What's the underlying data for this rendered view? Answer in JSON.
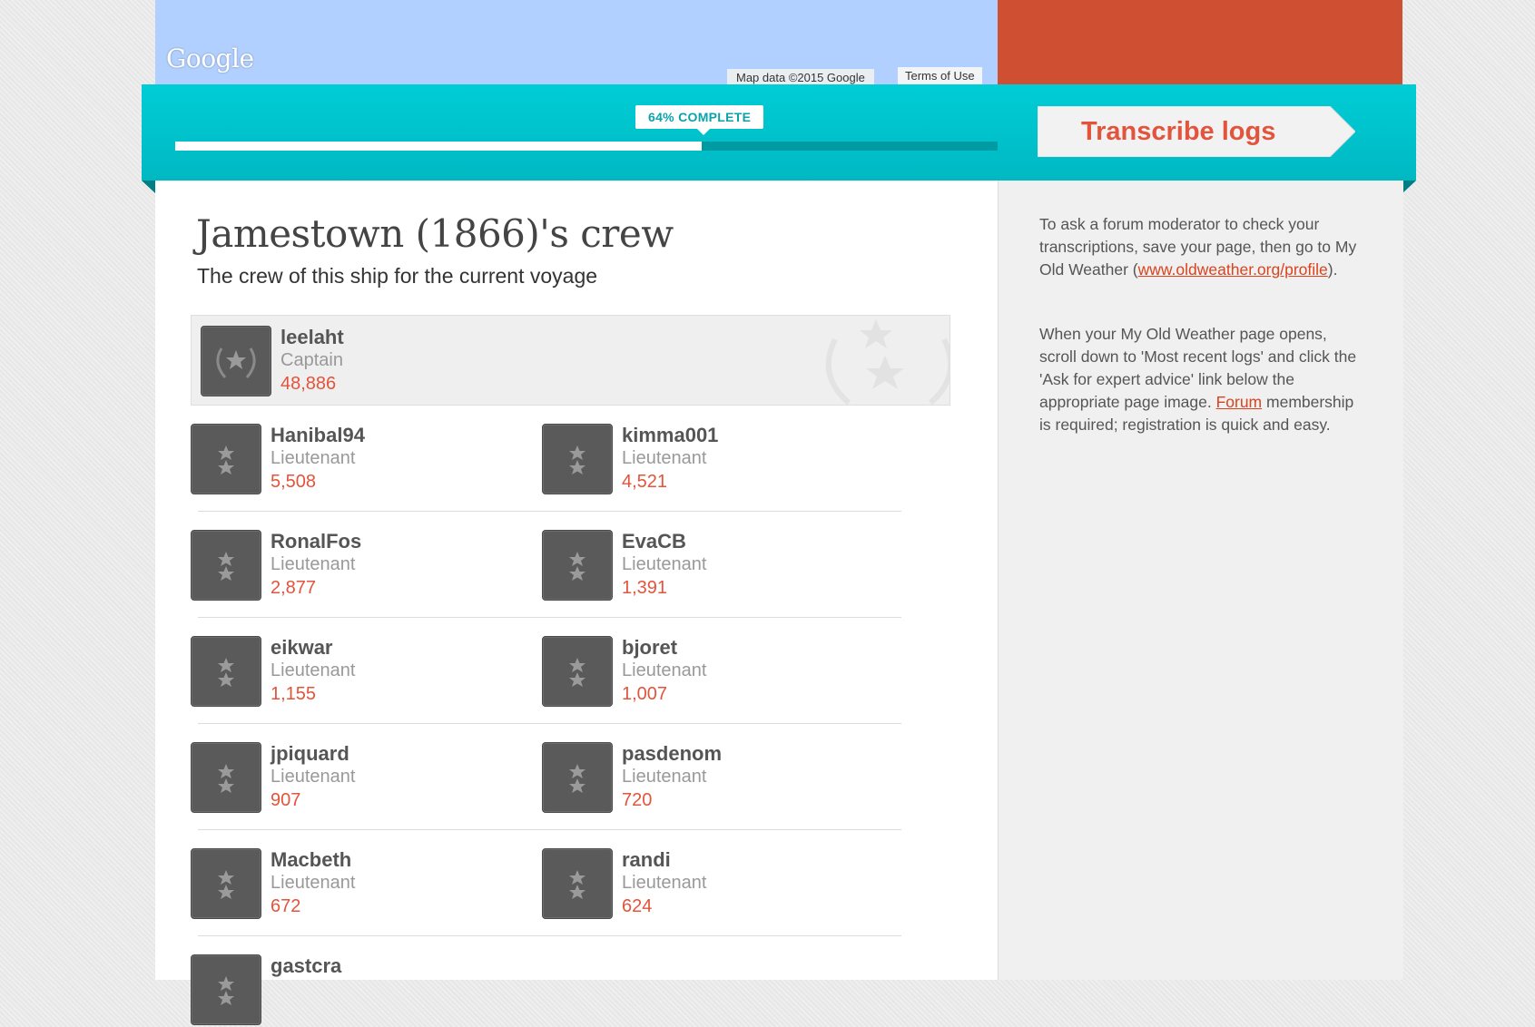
{
  "map": {
    "logo": "Google",
    "attribution": "Map data ©2015 Google",
    "terms": "Terms of Use"
  },
  "progress": {
    "label": "64% COMPLETE",
    "percent": 64
  },
  "transcribe_button": {
    "label": "Transcribe logs"
  },
  "crew": {
    "title": "Jamestown (1866)'s crew",
    "subtitle": "The crew of this ship for the current voyage",
    "captain": {
      "name": "leelaht",
      "rank": "Captain",
      "score": "48,886"
    },
    "members": [
      {
        "name": "Hanibal94",
        "rank": "Lieutenant",
        "score": "5,508"
      },
      {
        "name": "kimma001",
        "rank": "Lieutenant",
        "score": "4,521"
      },
      {
        "name": "RonalFos",
        "rank": "Lieutenant",
        "score": "2,877"
      },
      {
        "name": "EvaCB",
        "rank": "Lieutenant",
        "score": "1,391"
      },
      {
        "name": "eikwar",
        "rank": "Lieutenant",
        "score": "1,155"
      },
      {
        "name": "bjoret",
        "rank": "Lieutenant",
        "score": "1,007"
      },
      {
        "name": "jpiquard",
        "rank": "Lieutenant",
        "score": "907"
      },
      {
        "name": "pasdenom",
        "rank": "Lieutenant",
        "score": "720"
      },
      {
        "name": "Macbeth",
        "rank": "Lieutenant",
        "score": "672"
      },
      {
        "name": "randi",
        "rank": "Lieutenant",
        "score": "624"
      },
      {
        "name": "gastcra",
        "rank": "",
        "score": ""
      }
    ]
  },
  "sidebar": {
    "p1_text": "To ask a forum moderator to check your transcriptions, save your page, then go to My Old Weather (",
    "p1_link": "www.oldweather.org/profile",
    "p1_end": ").",
    "p2_text": "When your My Old Weather page opens, scroll down to 'Most recent logs' and click the 'Ask for expert advice' link below the appropriate page image. ",
    "p2_link": "Forum",
    "p2_end": " membership is required; registration is quick and easy."
  },
  "colors": {
    "teal": "#00c4cd",
    "accent_red": "#e2543b",
    "map_blue": "#b1d0ff",
    "brick": "#cf4f33"
  }
}
